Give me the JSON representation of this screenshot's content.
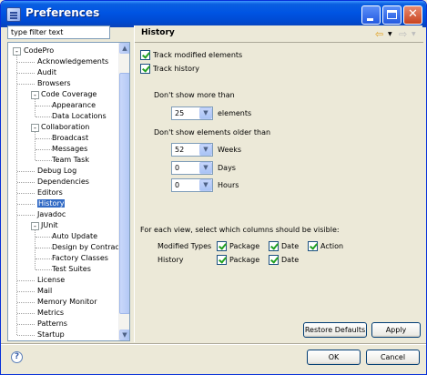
{
  "window": {
    "title": "Preferences"
  },
  "filter": {
    "placeholder": "type filter text",
    "value": "type filter text"
  },
  "tree": {
    "items": [
      {
        "label": "CodePro",
        "level": 0,
        "expander": "-"
      },
      {
        "label": "Acknowledgements",
        "level": 1
      },
      {
        "label": "Audit",
        "level": 1
      },
      {
        "label": "Browsers",
        "level": 1
      },
      {
        "label": "Code Coverage",
        "level": 1,
        "expander": "-"
      },
      {
        "label": "Appearance",
        "level": 2
      },
      {
        "label": "Data Locations",
        "level": 2
      },
      {
        "label": "Collaboration",
        "level": 1,
        "expander": "-"
      },
      {
        "label": "Broadcast",
        "level": 2
      },
      {
        "label": "Messages",
        "level": 2
      },
      {
        "label": "Team Task",
        "level": 2
      },
      {
        "label": "Debug Log",
        "level": 1
      },
      {
        "label": "Dependencies",
        "level": 1
      },
      {
        "label": "Editors",
        "level": 1
      },
      {
        "label": "History",
        "level": 1,
        "selected": true
      },
      {
        "label": "Javadoc",
        "level": 1
      },
      {
        "label": "JUnit",
        "level": 1,
        "expander": "-"
      },
      {
        "label": "Auto Update",
        "level": 2
      },
      {
        "label": "Design by Contract",
        "level": 2
      },
      {
        "label": "Factory Classes",
        "level": 2
      },
      {
        "label": "Test Suites",
        "level": 2
      },
      {
        "label": "License",
        "level": 1
      },
      {
        "label": "Mail",
        "level": 1
      },
      {
        "label": "Memory Monitor",
        "level": 1
      },
      {
        "label": "Metrics",
        "level": 1
      },
      {
        "label": "Patterns",
        "level": 1
      },
      {
        "label": "Startup",
        "level": 1
      }
    ]
  },
  "page": {
    "title": "History",
    "track_modified_label": "Track modified elements",
    "track_history_label": "Track history",
    "dont_show_more_label": "Don't show more than",
    "elements_value": "25",
    "elements_label": "elements",
    "dont_show_older_label": "Don't show elements older than",
    "weeks_value": "52",
    "weeks_label": "Weeks",
    "days_value": "0",
    "days_label": "Days",
    "hours_value": "0",
    "hours_label": "Hours",
    "columns_prompt": "For each view, select which columns should be visible:",
    "rows": [
      {
        "label": "Modified Types",
        "columns": [
          "Package",
          "Date",
          "Action"
        ]
      },
      {
        "label": "History",
        "columns": [
          "Package",
          "Date"
        ]
      }
    ],
    "restore_defaults_label": "Restore Defaults",
    "apply_label": "Apply"
  },
  "footer": {
    "ok_label": "OK",
    "cancel_label": "Cancel",
    "help_glyph": "?"
  },
  "colors": {
    "titlebar": "#0054e3",
    "selection": "#316ac5",
    "checkmark": "#21a121"
  }
}
